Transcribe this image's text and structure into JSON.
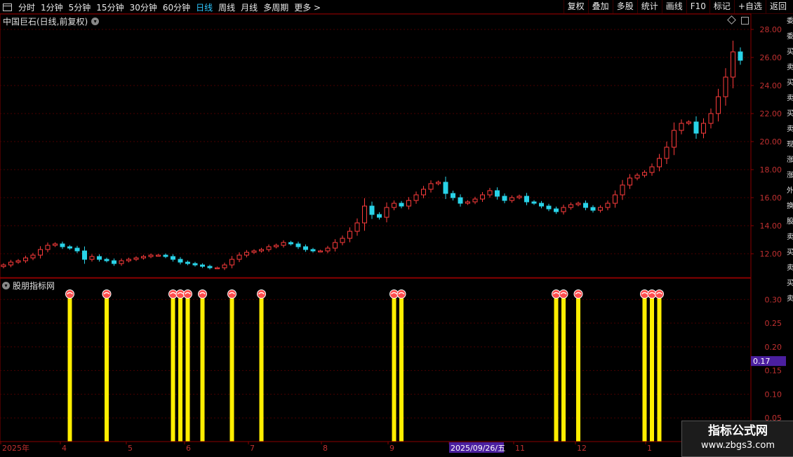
{
  "toolbar": {
    "periods": [
      "分时",
      "1分钟",
      "5分钟",
      "15分钟",
      "30分钟",
      "60分钟",
      "日线",
      "周线",
      "月线",
      "多周期",
      "更多 >"
    ],
    "active_period": "日线",
    "right_buttons": [
      "复权",
      "叠加",
      "多股",
      "统计",
      "画线",
      "F10",
      "标记",
      "+自选",
      "返回"
    ]
  },
  "main_panel": {
    "title": "中国巨石(日线,前复权)",
    "price_ticks": [
      "28.00",
      "26.00",
      "24.00",
      "22.00",
      "20.00",
      "18.00",
      "16.00",
      "14.00",
      "12.00"
    ]
  },
  "indicator_panel": {
    "title": "股朋指标网",
    "value_ticks": [
      "0.30",
      "0.25",
      "0.20",
      "0.15",
      "0.10",
      "0.05"
    ],
    "current_value": "0.17"
  },
  "date_axis": {
    "labels": [
      "2025年",
      "4",
      "5",
      "6",
      "7",
      "8",
      "9",
      "2025/09/26/五",
      "11",
      "12",
      "1"
    ]
  },
  "right_strip": {
    "chars": [
      "委",
      "委",
      "买",
      "卖",
      "买",
      "卖",
      "买",
      "卖",
      "现",
      "涨",
      "涨",
      "外",
      "换",
      "股",
      "卖",
      "买",
      "卖",
      "买",
      "卖"
    ]
  },
  "watermark": {
    "line1": "指标公式网",
    "line2": "www.zbgs3.com"
  },
  "colors": {
    "up": "#ff3b3b",
    "down": "#29d3e8",
    "signal_bar": "#ffee00",
    "grid": "#4a0000",
    "border": "#8a0000",
    "active_tab": "#2ec7ff",
    "current_value_bg": "#4b1fa0"
  },
  "chart_data": [
    {
      "type": "candlestick",
      "title": "中国巨石(日线,前复权)",
      "ylim": [
        10.5,
        29
      ],
      "close_series": [
        11.2,
        11.4,
        11.5,
        11.7,
        11.9,
        12.3,
        12.6,
        12.7,
        12.5,
        12.4,
        12.2,
        11.6,
        11.8,
        11.6,
        11.5,
        11.3,
        11.5,
        11.6,
        11.7,
        11.8,
        11.9,
        11.9,
        11.8,
        11.6,
        11.4,
        11.3,
        11.2,
        11.1,
        11.0,
        11.0,
        11.2,
        11.6,
        11.9,
        12.1,
        12.2,
        12.3,
        12.5,
        12.6,
        12.8,
        12.7,
        12.5,
        12.3,
        12.2,
        12.2,
        12.4,
        12.8,
        13.1,
        13.6,
        14.2,
        15.4,
        14.8,
        14.6,
        15.3,
        15.6,
        15.4,
        15.8,
        16.2,
        16.6,
        17.0,
        17.1,
        16.3,
        16.0,
        15.6,
        15.7,
        15.9,
        16.2,
        16.5,
        16.1,
        15.8,
        16.0,
        16.1,
        15.7,
        15.6,
        15.4,
        15.2,
        15.0,
        15.3,
        15.5,
        15.6,
        15.3,
        15.1,
        15.3,
        15.6,
        16.2,
        16.9,
        17.4,
        17.6,
        17.8,
        18.2,
        18.8,
        19.6,
        20.8,
        21.3,
        21.4,
        20.6,
        21.3,
        22.0,
        23.2,
        24.6,
        26.4,
        25.8
      ]
    },
    {
      "type": "bar",
      "title": "股朋指标网",
      "ylim": [
        0,
        0.33
      ],
      "signal_value": 0.31,
      "signal_dates_index": [
        9,
        14,
        23,
        24,
        25,
        27,
        31,
        35,
        53,
        54,
        75,
        76,
        78,
        87,
        88,
        89
      ]
    }
  ]
}
